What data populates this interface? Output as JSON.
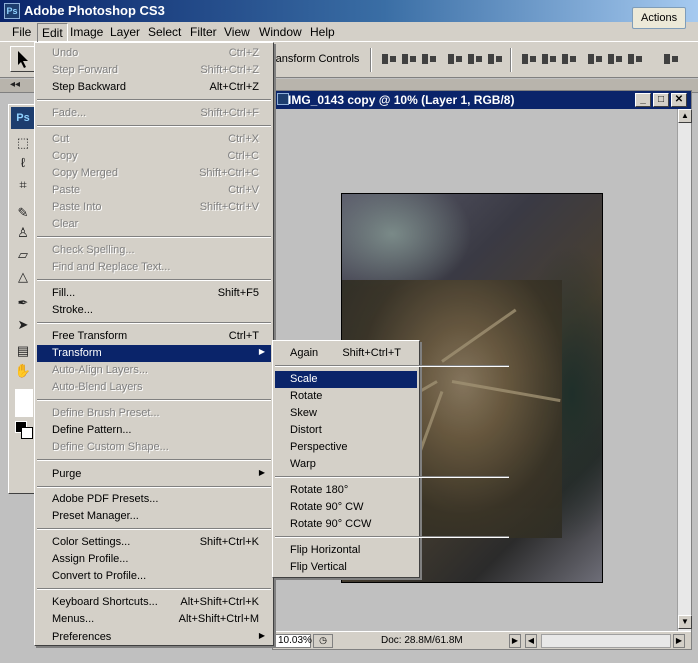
{
  "app": {
    "title": "Adobe Photoshop CS3",
    "icon_text": "Ps"
  },
  "menubar": {
    "items": [
      "File",
      "Edit",
      "Image",
      "Layer",
      "Select",
      "Filter",
      "View",
      "Window",
      "Help"
    ]
  },
  "actions_button": "Actions",
  "options_bar": {
    "transform_label": "ransform Controls"
  },
  "toolbox": {
    "logo": "Ps"
  },
  "document": {
    "title": "IMG_0143 copy @ 10% (Layer 1, RGB/8)",
    "zoom": "10.03%",
    "doc_size": "Doc: 28.8M/61.8M"
  },
  "edit_menu": {
    "items": [
      {
        "label": "Undo",
        "shortcut": "Ctrl+Z",
        "disabled": true
      },
      {
        "label": "Step Forward",
        "shortcut": "Shift+Ctrl+Z",
        "disabled": true
      },
      {
        "label": "Step Backward",
        "shortcut": "Alt+Ctrl+Z",
        "disabled": false
      },
      {
        "label": "Fade...",
        "shortcut": "Shift+Ctrl+F",
        "disabled": true
      },
      {
        "label": "Cut",
        "shortcut": "Ctrl+X",
        "disabled": true
      },
      {
        "label": "Copy",
        "shortcut": "Ctrl+C",
        "disabled": true
      },
      {
        "label": "Copy Merged",
        "shortcut": "Shift+Ctrl+C",
        "disabled": true
      },
      {
        "label": "Paste",
        "shortcut": "Ctrl+V",
        "disabled": true
      },
      {
        "label": "Paste Into",
        "shortcut": "Shift+Ctrl+V",
        "disabled": true
      },
      {
        "label": "Clear",
        "shortcut": "",
        "disabled": true
      },
      {
        "label": "Check Spelling...",
        "shortcut": "",
        "disabled": true
      },
      {
        "label": "Find and Replace Text...",
        "shortcut": "",
        "disabled": true
      },
      {
        "label": "Fill...",
        "shortcut": "Shift+F5",
        "disabled": false
      },
      {
        "label": "Stroke...",
        "shortcut": "",
        "disabled": false
      },
      {
        "label": "Free Transform",
        "shortcut": "Ctrl+T",
        "disabled": false
      },
      {
        "label": "Transform",
        "shortcut": "",
        "disabled": false
      },
      {
        "label": "Auto-Align Layers...",
        "shortcut": "",
        "disabled": true
      },
      {
        "label": "Auto-Blend Layers",
        "shortcut": "",
        "disabled": true
      },
      {
        "label": "Define Brush Preset...",
        "shortcut": "",
        "disabled": true
      },
      {
        "label": "Define Pattern...",
        "shortcut": "",
        "disabled": false
      },
      {
        "label": "Define Custom Shape...",
        "shortcut": "",
        "disabled": true
      },
      {
        "label": "Purge",
        "shortcut": "",
        "disabled": false
      },
      {
        "label": "Adobe PDF Presets...",
        "shortcut": "",
        "disabled": false
      },
      {
        "label": "Preset Manager...",
        "shortcut": "",
        "disabled": false
      },
      {
        "label": "Color Settings...",
        "shortcut": "Shift+Ctrl+K",
        "disabled": false
      },
      {
        "label": "Assign Profile...",
        "shortcut": "",
        "disabled": false
      },
      {
        "label": "Convert to Profile...",
        "shortcut": "",
        "disabled": false
      },
      {
        "label": "Keyboard Shortcuts...",
        "shortcut": "Alt+Shift+Ctrl+K",
        "disabled": false
      },
      {
        "label": "Menus...",
        "shortcut": "Alt+Shift+Ctrl+M",
        "disabled": false
      },
      {
        "label": "Preferences",
        "shortcut": "",
        "disabled": false
      }
    ]
  },
  "transform_submenu": {
    "items": [
      {
        "label": "Again",
        "shortcut": "Shift+Ctrl+T"
      },
      {
        "label": "Scale",
        "shortcut": ""
      },
      {
        "label": "Rotate",
        "shortcut": ""
      },
      {
        "label": "Skew",
        "shortcut": ""
      },
      {
        "label": "Distort",
        "shortcut": ""
      },
      {
        "label": "Perspective",
        "shortcut": ""
      },
      {
        "label": "Warp",
        "shortcut": ""
      },
      {
        "label": "Rotate 180°",
        "shortcut": ""
      },
      {
        "label": "Rotate 90° CW",
        "shortcut": ""
      },
      {
        "label": "Rotate 90° CCW",
        "shortcut": ""
      },
      {
        "label": "Flip Horizontal",
        "shortcut": ""
      },
      {
        "label": "Flip Vertical",
        "shortcut": ""
      }
    ]
  },
  "colors": {
    "highlight": "#0a246a",
    "menu_bg": "#d4d0c8",
    "disabled_text": "#808080"
  }
}
